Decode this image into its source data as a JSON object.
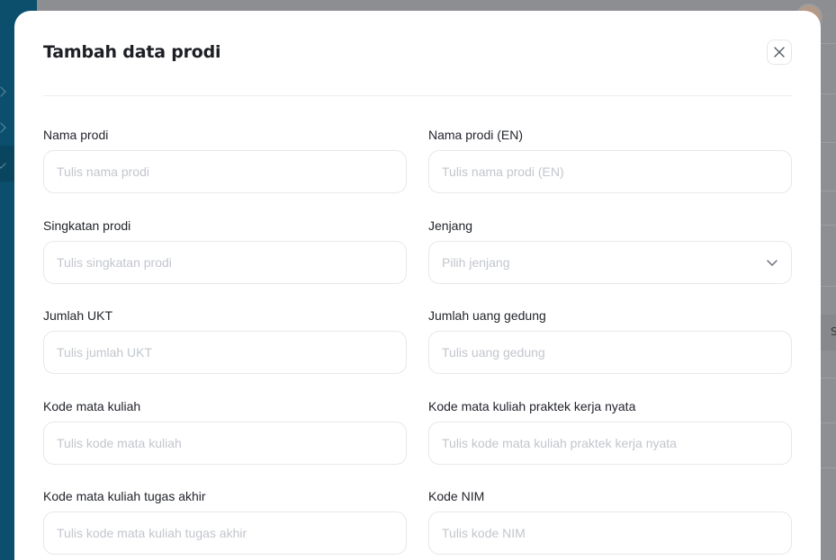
{
  "modal": {
    "title": "Tambah data prodi"
  },
  "fields": {
    "nama_prodi": {
      "label": "Nama prodi",
      "placeholder": "Tulis nama prodi",
      "value": ""
    },
    "nama_prodi_en": {
      "label": "Nama prodi (EN)",
      "placeholder": "Tulis nama prodi (EN)",
      "value": ""
    },
    "singkatan_prodi": {
      "label": "Singkatan prodi",
      "placeholder": "Tulis singkatan prodi",
      "value": ""
    },
    "jenjang": {
      "label": "Jenjang",
      "placeholder": "Pilih jenjang"
    },
    "jumlah_ukt": {
      "label": "Jumlah UKT",
      "placeholder": "Tulis jumlah UKT",
      "value": ""
    },
    "jumlah_uang_gedung": {
      "label": "Jumlah uang gedung",
      "placeholder": "Tulis uang gedung",
      "value": ""
    },
    "kode_mk": {
      "label": "Kode mata kuliah",
      "placeholder": "Tulis kode mata kuliah",
      "value": ""
    },
    "kode_mk_kkn": {
      "label": "Kode mata kuliah praktek kerja nyata",
      "placeholder": "Tulis kode mata kuliah praktek kerja nyata",
      "value": ""
    },
    "kode_mk_ta": {
      "label": "Kode mata kuliah tugas akhir",
      "placeholder": "Tulis kode mata kuliah tugas akhir",
      "value": ""
    },
    "kode_nim": {
      "label": "Kode NIM",
      "placeholder": "Tulis kode NIM",
      "value": ""
    }
  },
  "background": {
    "chip_text": "S"
  },
  "colors": {
    "sidebar": "#0b4f6c",
    "overlay": "#8d8f93",
    "modal_bg": "#ffffff",
    "input_border": "#e6e8eb",
    "placeholder": "#c2c6cc",
    "text": "#22252b"
  },
  "icons": {
    "close": "close-icon",
    "select": "chevron-down-icon"
  }
}
